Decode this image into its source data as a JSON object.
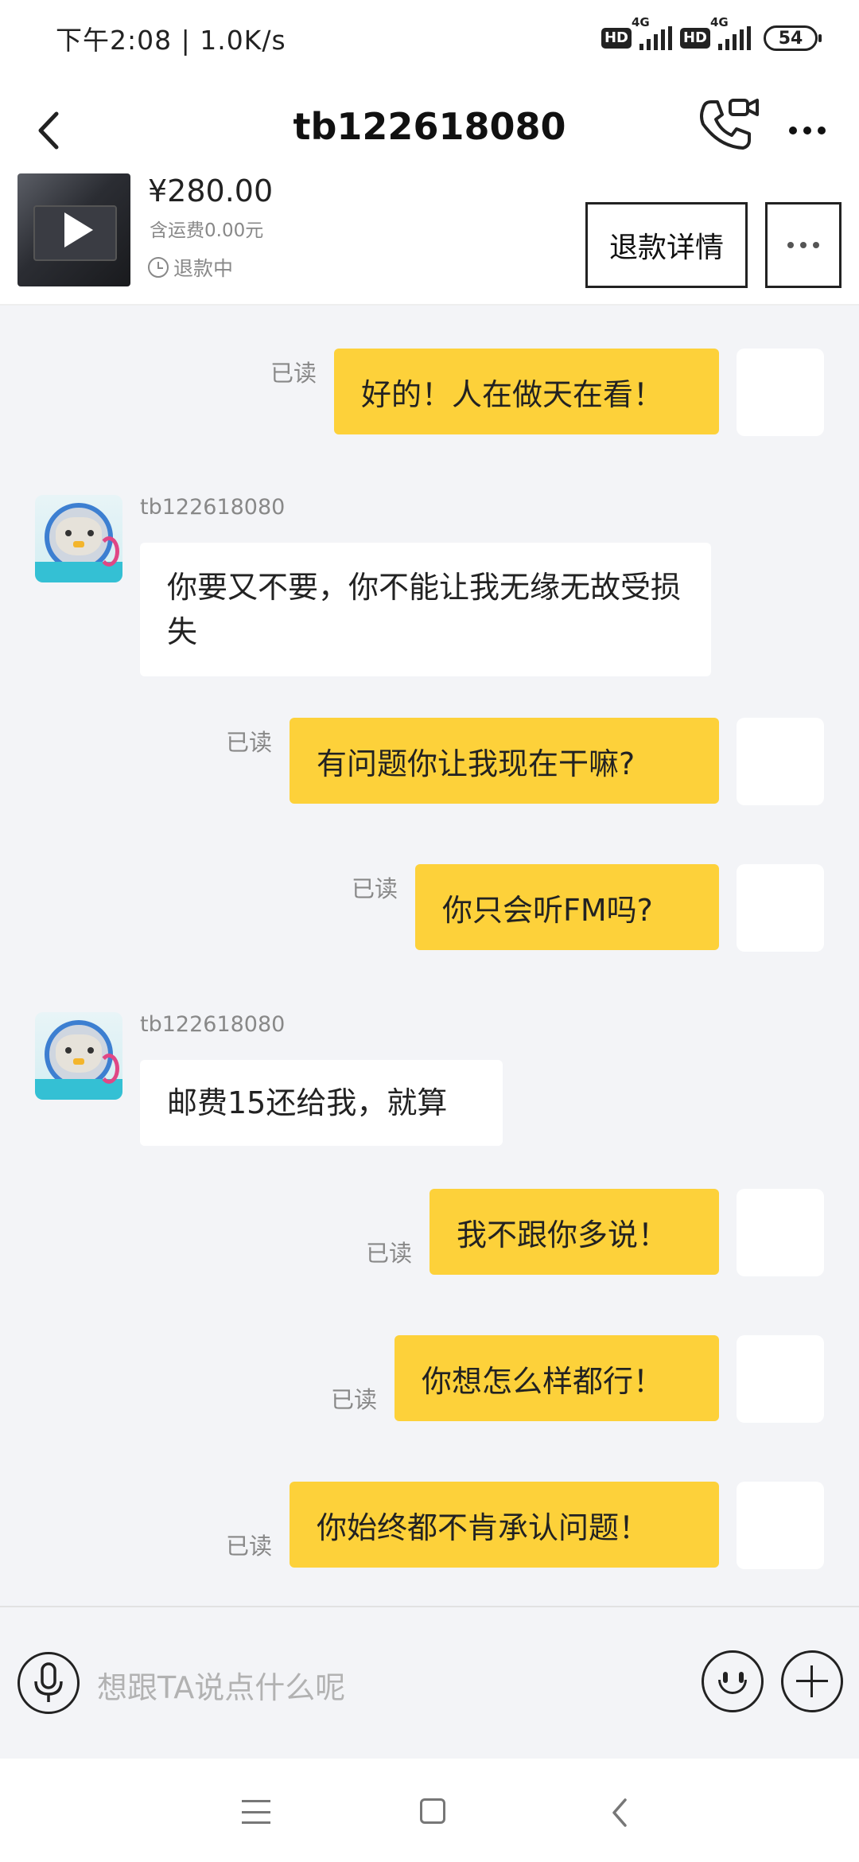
{
  "status_bar": {
    "time_speed": "下午2:08 | 1.0K/s",
    "hd1": "HD",
    "net1": "4G",
    "hd2": "HD",
    "net2": "4G",
    "battery": "54"
  },
  "header": {
    "title": "tb122618080"
  },
  "product": {
    "price": "¥280.00",
    "shipping": "含运费0.00元",
    "status": "退款中",
    "refund_details_label": "退款详情"
  },
  "messages": [
    {
      "dir": "out",
      "text": "好的！人在做天在看！",
      "read": "已读"
    },
    {
      "dir": "in",
      "sender": "tb122618080",
      "text": "你要又不要，你不能让我无缘无故受损失"
    },
    {
      "dir": "out",
      "text": "有问题你让我现在干嘛?",
      "read": "已读"
    },
    {
      "dir": "out",
      "text": "你只会听FM吗?",
      "read": "已读"
    },
    {
      "dir": "in",
      "sender": "tb122618080",
      "text": "邮费15还给我，就算"
    },
    {
      "dir": "out",
      "text": "我不跟你多说！",
      "read": "已读"
    },
    {
      "dir": "out",
      "text": "你想怎么样都行！",
      "read": "已读"
    },
    {
      "dir": "out",
      "text": "你始终都不肯承认问题！",
      "read": "已读"
    }
  ],
  "input": {
    "placeholder": "想跟TA说点什么呢"
  }
}
